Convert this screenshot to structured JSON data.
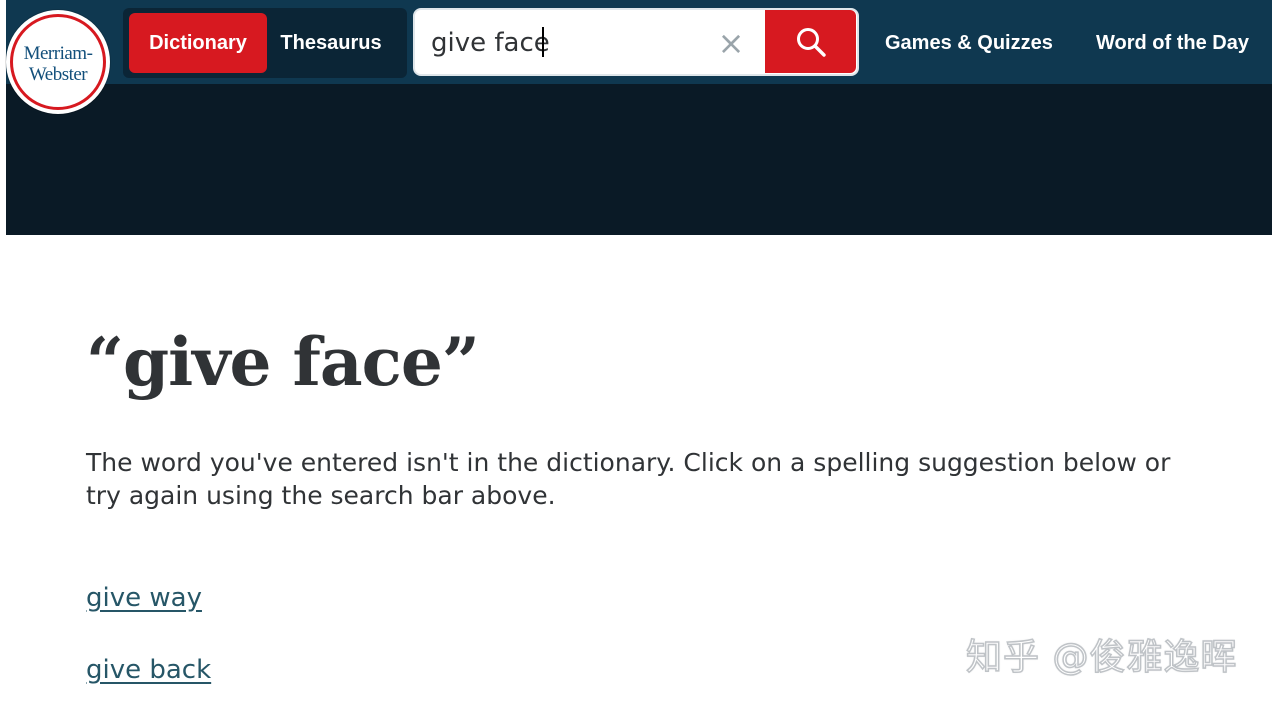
{
  "header": {
    "logo_line1": "Merriam-",
    "logo_line2": "Webster",
    "tabs": [
      {
        "label": "Dictionary",
        "active": true
      },
      {
        "label": "Thesaurus",
        "active": false
      }
    ],
    "search": {
      "value": "give face",
      "clear_glyph": "×"
    },
    "nav": [
      {
        "label": "Games & Quizzes"
      },
      {
        "label": "Word of the Day"
      }
    ]
  },
  "colors": {
    "header_bg": "#0f3850",
    "band_bg": "#0a1a26",
    "accent_red": "#d71920",
    "link": "#265667"
  },
  "main": {
    "headword": "“give face”",
    "message": "The word you've entered isn't in the dictionary. Click on a spelling suggestion below or try again using the search bar above.",
    "suggestions": [
      {
        "label": "give way"
      },
      {
        "label": "give back"
      }
    ]
  },
  "watermark": "知乎 @俊雅逸晖"
}
